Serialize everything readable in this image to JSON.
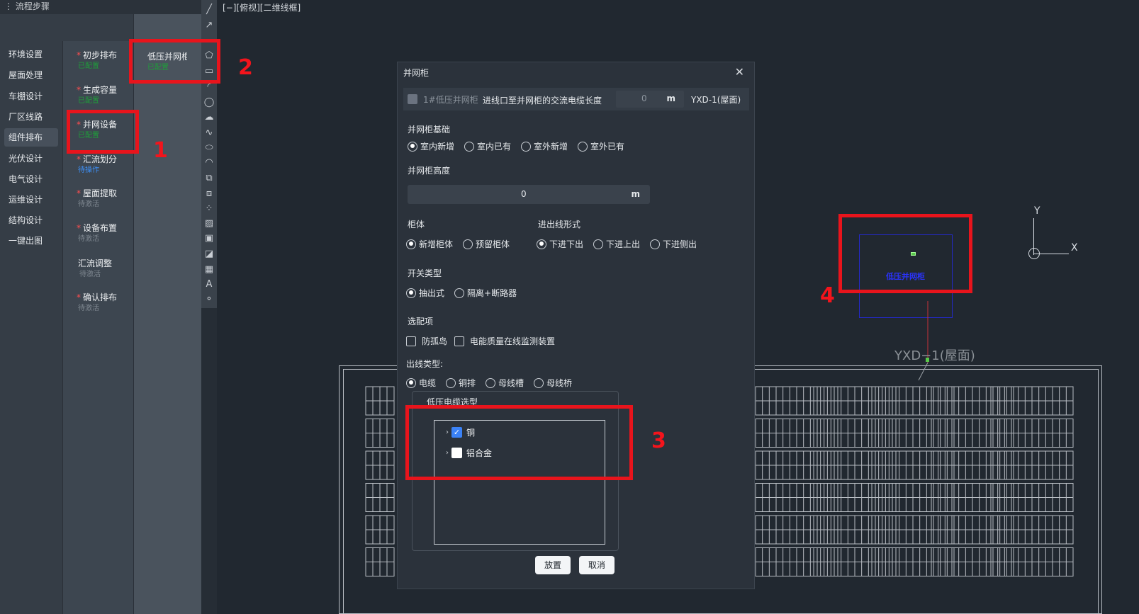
{
  "flow": {
    "header": "流程步骤",
    "nav": [
      "环境设置",
      "屋面处理",
      "车棚设计",
      "厂区线路",
      "组件排布",
      "光伏设计",
      "电气设计",
      "运维设计",
      "结构设计",
      "一键出图"
    ],
    "steps": [
      {
        "title": "初步排布",
        "status": "已配置",
        "status_type": "green",
        "required": true
      },
      {
        "title": "生成容量",
        "status": "已配置",
        "status_type": "green",
        "required": true
      },
      {
        "title": "并网设备",
        "status": "已配置",
        "status_type": "green",
        "required": true
      },
      {
        "title": "汇流划分",
        "status": "待操作",
        "status_type": "blue",
        "required": true
      },
      {
        "title": "屋面提取",
        "status": "待激活",
        "status_type": "gray",
        "required": true
      },
      {
        "title": "设备布置",
        "status": "待激活",
        "status_type": "gray",
        "required": true
      },
      {
        "title": "汇流调整",
        "status": "待激活",
        "status_type": "gray",
        "required": false
      },
      {
        "title": "确认排布",
        "status": "待激活",
        "status_type": "gray",
        "required": true
      }
    ],
    "sub_step": {
      "title": "低压并网柜",
      "status": "已配置"
    }
  },
  "viewport": {
    "label": "[−][俯视][二维线框]",
    "yxd_label": "YXD−1(屋面)",
    "device_label": "低压并网柜",
    "axis_x": "X",
    "axis_y": "Y"
  },
  "dialog": {
    "title": "并网柜",
    "close": "✕",
    "cabinet_row": {
      "name": "1#低压并网柜",
      "label": "进线口至并网柜的交流电缆长度",
      "value": "0",
      "unit": "m",
      "location": "YXD-1(屋面)"
    },
    "foundation": {
      "title": "并网柜基础",
      "options": [
        "室内新增",
        "室内已有",
        "室外新增",
        "室外已有"
      ],
      "selected": "室内新增"
    },
    "height": {
      "title": "并网柜高度",
      "value": "0",
      "unit": "m"
    },
    "cabinet": {
      "title": "柜体",
      "options": [
        "新增柜体",
        "预留柜体"
      ],
      "selected": "新增柜体"
    },
    "inout": {
      "title": "进出线形式",
      "options": [
        "下进下出",
        "下进上出",
        "下进侧出"
      ],
      "selected": "下进下出"
    },
    "switch": {
      "title": "开关类型",
      "options": [
        "抽出式",
        "隔离+断路器"
      ],
      "selected": "抽出式"
    },
    "options": {
      "title": "选配项",
      "items": [
        "防孤岛",
        "电能质量在线监测装置"
      ]
    },
    "outline": {
      "title": "出线类型:",
      "options": [
        "电缆",
        "铜排",
        "母线槽",
        "母线桥"
      ],
      "selected": "电缆"
    },
    "cable": {
      "title": "低压电缆选型",
      "items": [
        {
          "label": "铜",
          "checked": true
        },
        {
          "label": "铝合金",
          "checked": false
        }
      ]
    },
    "place_button": "放置",
    "cancel_button": "取消"
  },
  "annotations": [
    "1",
    "2",
    "3",
    "4"
  ],
  "colors": {
    "annotation_red": "#e8141c",
    "selected_blue": "#3b82f6",
    "status_green": "#1f9d3a",
    "status_blue": "#3d8ff5"
  }
}
